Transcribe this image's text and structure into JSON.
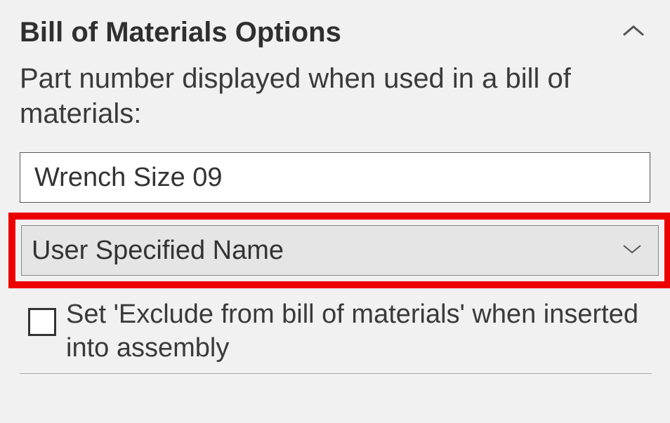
{
  "section": {
    "title": "Bill of Materials Options",
    "description": "Part number displayed when used in a bill of materials:"
  },
  "partNumberInput": {
    "value": "Wrench Size 09"
  },
  "nameSourceDropdown": {
    "selected": "User Specified Name"
  },
  "excludeCheckbox": {
    "checked": false,
    "label": "Set 'Exclude from bill of materials' when inserted into assembly"
  }
}
